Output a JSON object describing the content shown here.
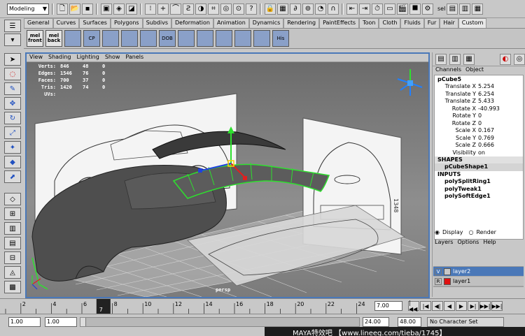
{
  "status_line": {
    "mode": "Modeling",
    "extra_label": "sel"
  },
  "shelf_tabs": [
    "General",
    "Curves",
    "Surfaces",
    "Polygons",
    "Subdivs",
    "Deformation",
    "Animation",
    "Dynamics",
    "Rendering",
    "PaintEffects",
    "Toon",
    "Cloth",
    "Fluids",
    "Fur",
    "Hair",
    "Custom"
  ],
  "shelf_buttons": [
    {
      "label": "mel",
      "sub": "front"
    },
    {
      "label": "mel",
      "sub": "back"
    },
    {
      "label": "",
      "sub": ""
    },
    {
      "label": "CP",
      "sub": ""
    },
    {
      "label": "",
      "sub": ""
    },
    {
      "label": "",
      "sub": ""
    },
    {
      "label": "",
      "sub": ""
    },
    {
      "label": "DOB",
      "sub": ""
    },
    {
      "label": "",
      "sub": ""
    },
    {
      "label": "",
      "sub": ""
    },
    {
      "label": "",
      "sub": ""
    },
    {
      "label": "",
      "sub": ""
    },
    {
      "label": "",
      "sub": ""
    },
    {
      "label": "His",
      "sub": ""
    }
  ],
  "viewport": {
    "menu": [
      "View",
      "Shading",
      "Lighting",
      "Show",
      "Panels"
    ],
    "hud": [
      {
        "label": "Verts:",
        "a": "846",
        "b": "48",
        "c": "0"
      },
      {
        "label": "Edges:",
        "a": "1546",
        "b": "76",
        "c": "0"
      },
      {
        "label": "Faces:",
        "a": "700",
        "b": "37",
        "c": "0"
      },
      {
        "label": "Tris:",
        "a": "1420",
        "b": "74",
        "c": "0"
      },
      {
        "label": "UVs:",
        "a": "",
        "b": "",
        "c": ""
      }
    ],
    "camera_label": "persp",
    "dimension_label": "1348"
  },
  "channel_box": {
    "menu": [
      "Channels",
      "Object"
    ],
    "object_name": "pCube5",
    "attributes": [
      {
        "name": "Translate X",
        "value": "5.254"
      },
      {
        "name": "Translate Y",
        "value": "6.254"
      },
      {
        "name": "Translate Z",
        "value": "5.433"
      },
      {
        "name": "Rotate X",
        "value": "-40.993"
      },
      {
        "name": "Rotate Y",
        "value": "0"
      },
      {
        "name": "Rotate Z",
        "value": "0"
      },
      {
        "name": "Scale X",
        "value": "0.167"
      },
      {
        "name": "Scale Y",
        "value": "0.769"
      },
      {
        "name": "Scale Z",
        "value": "0.666"
      },
      {
        "name": "Visibility",
        "value": "on"
      }
    ],
    "shapes_header": "SHAPES",
    "shape_name": "pCubeShape1",
    "inputs_header": "INPUTS",
    "inputs": [
      "polySplitRing1",
      "polyTweak1",
      "polySoftEdge1"
    ]
  },
  "layers": {
    "display_label": "Display",
    "render_label": "Render",
    "menu": [
      "Layers",
      "Options",
      "Help"
    ],
    "rows": [
      {
        "flag": "V",
        "name": "layer2",
        "color": "#c8c8c8",
        "selected": true
      },
      {
        "flag": "R",
        "name": "layer1",
        "color": "#e01010",
        "selected": false
      }
    ]
  },
  "timeline": {
    "ticks": [
      "2",
      "4",
      "6",
      "8",
      "10",
      "12",
      "14",
      "16",
      "18",
      "20",
      "22",
      "24"
    ],
    "current_frame": "7",
    "current_time_field": "7.00"
  },
  "range": {
    "start": "1.00",
    "start_inner": "1.00",
    "end_inner": "24.00",
    "end": "48.00",
    "character_set": "No Character Set"
  },
  "watermark": "MAYA特效吧 【www.lineeg.com/tieba/1745】",
  "colors": {
    "viewport_border": "#4a78b8",
    "selection_green": "#2ee02e",
    "layer_selected": "#4a78b8"
  }
}
